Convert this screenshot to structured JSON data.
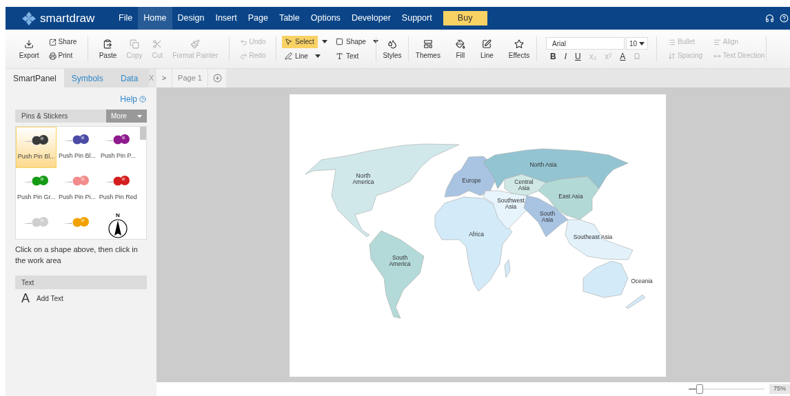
{
  "header": {
    "logo": "smartdraw",
    "menu": [
      {
        "label": "File",
        "selected": false
      },
      {
        "label": "Home",
        "selected": true
      },
      {
        "label": "Design",
        "selected": false
      },
      {
        "label": "Insert",
        "selected": false
      },
      {
        "label": "Page",
        "selected": false
      },
      {
        "label": "Table",
        "selected": false
      },
      {
        "label": "Options",
        "selected": false
      },
      {
        "label": "Developer",
        "selected": false
      },
      {
        "label": "Support",
        "selected": false
      }
    ],
    "buy": "Buy"
  },
  "toolbar": {
    "file": [
      {
        "label": "Export",
        "disabled": false
      },
      {
        "label": "Share",
        "disabled": false
      },
      {
        "label": "Print",
        "disabled": false
      }
    ],
    "clipboard": [
      {
        "label": "Paste",
        "disabled": false
      },
      {
        "label": "Copy",
        "disabled": true
      },
      {
        "label": "Cut",
        "disabled": true
      },
      {
        "label": "Format Painter",
        "disabled": true
      }
    ],
    "history": [
      {
        "label": "Undo",
        "disabled": true
      },
      {
        "label": "Redo",
        "disabled": true
      }
    ],
    "tools": [
      {
        "label": "Select",
        "selected": true
      },
      {
        "label": "Shape",
        "selected": false
      },
      {
        "label": "Line",
        "selected": false
      },
      {
        "label": "Text",
        "selected": false
      }
    ],
    "styles": {
      "label": "Styles"
    },
    "format": [
      {
        "label": "Themes"
      },
      {
        "label": "Fill"
      },
      {
        "label": "Line"
      },
      {
        "label": "Effects"
      }
    ],
    "font": {
      "family": "Arial",
      "size": "10"
    },
    "text_style": [
      {
        "label": "B",
        "disabled": false
      },
      {
        "label": "I",
        "disabled": false
      },
      {
        "label": "U",
        "disabled": false
      },
      {
        "label": "x₂",
        "disabled": true
      },
      {
        "label": "x²",
        "disabled": true
      },
      {
        "label": "A",
        "disabled": false
      },
      {
        "label": "Ω",
        "disabled": true
      }
    ],
    "paragraph": [
      {
        "label": "Bullet",
        "disabled": true
      },
      {
        "label": "Align",
        "disabled": true
      },
      {
        "label": "Spacing",
        "disabled": true
      },
      {
        "label": "Text Direction",
        "disabled": true
      }
    ]
  },
  "panel": {
    "tabs": [
      {
        "label": "SmartPanel",
        "selected": true
      },
      {
        "label": "Symbols",
        "selected": false
      },
      {
        "label": "Data",
        "selected": false
      }
    ],
    "close": "X",
    "help": "Help",
    "library": "Pins & Stickers",
    "more": "More",
    "symbols": [
      {
        "kind": "pin",
        "label": "Push Pin Bl...",
        "color": "#3a3a3a",
        "selected": true
      },
      {
        "kind": "pin",
        "label": "Push Pin Bl...",
        "color": "#4b4ba6",
        "selected": false
      },
      {
        "kind": "pin",
        "label": "Push Pin P...",
        "color": "#8e1a8e",
        "selected": false
      },
      {
        "kind": "pin",
        "label": "Push Pin Gr...",
        "color": "#159a15",
        "selected": false
      },
      {
        "kind": "pin",
        "label": "Push Pin Pi...",
        "color": "#f28b8b",
        "selected": false
      },
      {
        "kind": "pin",
        "label": "Push Pin Red",
        "color": "#d41e1e",
        "selected": false
      },
      {
        "kind": "pin",
        "color": "#cfcfcf",
        "selected": false
      },
      {
        "kind": "pin",
        "color": "#f2a100",
        "selected": false
      },
      {
        "kind": "compass",
        "mark": "N",
        "selected": false
      }
    ],
    "hint": "Click on a shape above, then click in the work area",
    "text_section": "Text",
    "text_items": [
      {
        "glyph": "A",
        "label": "Add Text"
      }
    ]
  },
  "pages": {
    "nav": ">",
    "tabs": [
      {
        "label": "Page 1",
        "selected": true
      }
    ]
  },
  "map": {
    "regions": [
      {
        "label": "North America",
        "color": "#d0e8ea"
      },
      {
        "label": "South America",
        "color": "#b3dad8"
      },
      {
        "label": "Europe",
        "color": "#a9c4e2"
      },
      {
        "label": "Africa",
        "color": "#d3eaf8"
      },
      {
        "label": "North Asia",
        "color": "#93c4d2"
      },
      {
        "label": "Central Asia",
        "color": "#cfe8e6"
      },
      {
        "label": "East Asia",
        "color": "#b2d9d6"
      },
      {
        "label": "Southwest Asia",
        "color": "#e7f4fb"
      },
      {
        "label": "South Asia",
        "color": "#a9c4e2"
      },
      {
        "label": "Southeast Asia",
        "color": "#e3f2fa"
      },
      {
        "label": "Oceania",
        "color": "#d3eaf8"
      }
    ]
  },
  "zoom": {
    "level": 0.15,
    "reading": "75%"
  }
}
